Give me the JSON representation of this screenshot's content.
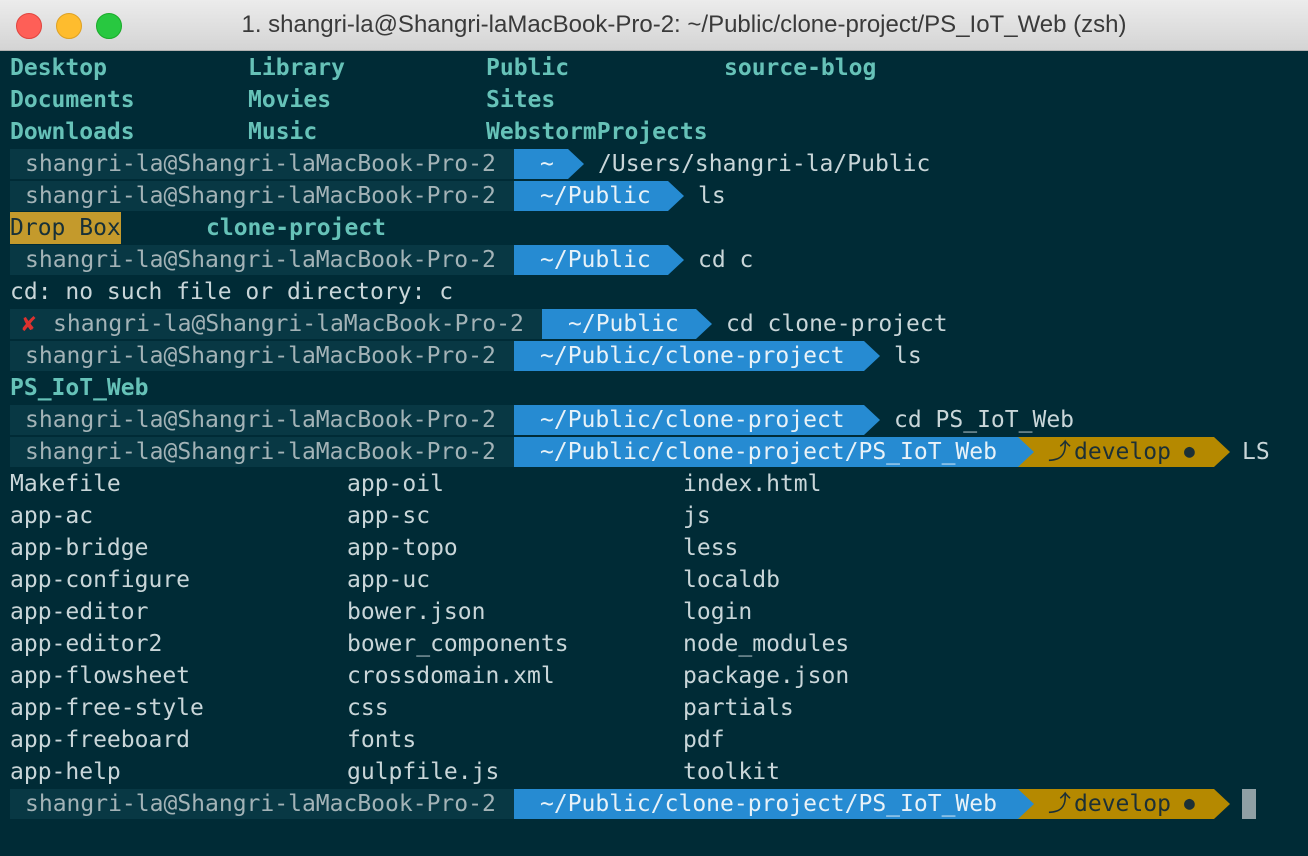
{
  "window": {
    "title": "1. shangri-la@Shangri-laMacBook-Pro-2: ~/Public/clone-project/PS_IoT_Web (zsh)"
  },
  "home_listing": [
    [
      "Desktop",
      "Library",
      "Public",
      "source-blog"
    ],
    [
      "Documents",
      "Movies",
      "Sites",
      ""
    ],
    [
      "Downloads",
      "Music",
      "WebstormProjects",
      ""
    ]
  ],
  "prompts": {
    "user": "shangri-la@Shangri-laMacBook-Pro-2",
    "error_mark": "✘",
    "git_branch": "develop",
    "git_icon": "⤴",
    "git_dot": "●"
  },
  "lines": {
    "p1_path": "~",
    "p1_cmd": "/Users/shangri-la/Public",
    "p2_path": "~/Public",
    "p2_cmd": "ls",
    "public_listing": [
      "Drop Box",
      "clone-project"
    ],
    "p3_path": "~/Public",
    "p3_cmd": "cd c",
    "error_text": "cd: no such file or directory: c",
    "p4_path": "~/Public",
    "p4_cmd": "cd clone-project",
    "p5_path": "~/Public/clone-project",
    "p5_cmd": "ls",
    "clone_listing": "PS_IoT_Web",
    "p6_path": "~/Public/clone-project",
    "p6_cmd": "cd PS_IoT_Web",
    "p7_path": "~/Public/clone-project/PS_IoT_Web",
    "p7_cmd": "LS",
    "p8_path": "~/Public/clone-project/PS_IoT_Web"
  },
  "project_listing": [
    [
      "Makefile",
      "app-oil",
      "index.html"
    ],
    [
      "app-ac",
      "app-sc",
      "js"
    ],
    [
      "app-bridge",
      "app-topo",
      "less"
    ],
    [
      "app-configure",
      "app-uc",
      "localdb"
    ],
    [
      "app-editor",
      "bower.json",
      "login"
    ],
    [
      "app-editor2",
      "bower_components",
      "node_modules"
    ],
    [
      "app-flowsheet",
      "crossdomain.xml",
      "package.json"
    ],
    [
      "app-free-style",
      "css",
      "partials"
    ],
    [
      "app-freeboard",
      "fonts",
      "pdf"
    ],
    [
      "app-help",
      "gulpfile.js",
      "toolkit"
    ]
  ],
  "colors": {
    "background": "#002b36",
    "path_segment": "#268bd2",
    "user_segment": "#083844",
    "git_segment": "#b58900",
    "directory_text": "#66c2b8",
    "error": "#dc322f"
  }
}
